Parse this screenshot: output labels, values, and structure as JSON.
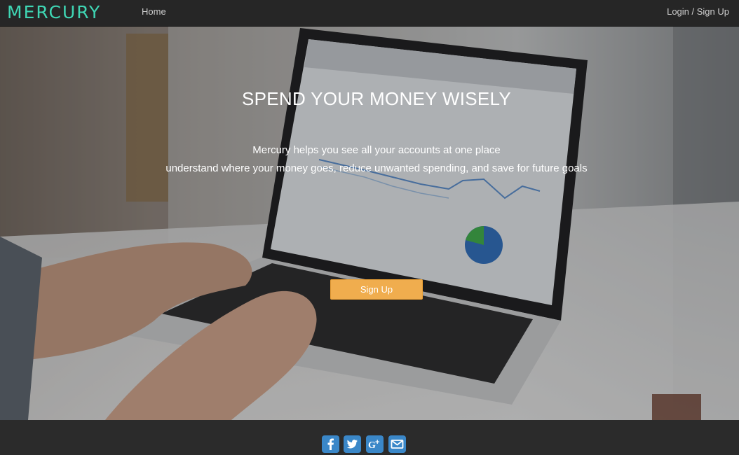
{
  "nav": {
    "brand": "MERCURY",
    "home": "Home",
    "login": "Login / Sign Up"
  },
  "hero": {
    "title": "SPEND YOUR MONEY WISELY",
    "line1": "Mercury helps you see all your accounts at one place",
    "line2": "understand where your money goes, reduce unwanted spending, and save for future goals",
    "cta": "Sign Up",
    "background": "photo of hands typing on a laptop showing an analytics dashboard"
  },
  "footer": {
    "social_icons": [
      "facebook-icon",
      "twitter-icon",
      "google-plus-icon",
      "email-icon"
    ]
  },
  "colors": {
    "brand": "#3fd6b4",
    "navbar": "#262626",
    "cta": "#f0ad4e",
    "social": "#3a87c8",
    "footer": "#2b2b2b"
  }
}
